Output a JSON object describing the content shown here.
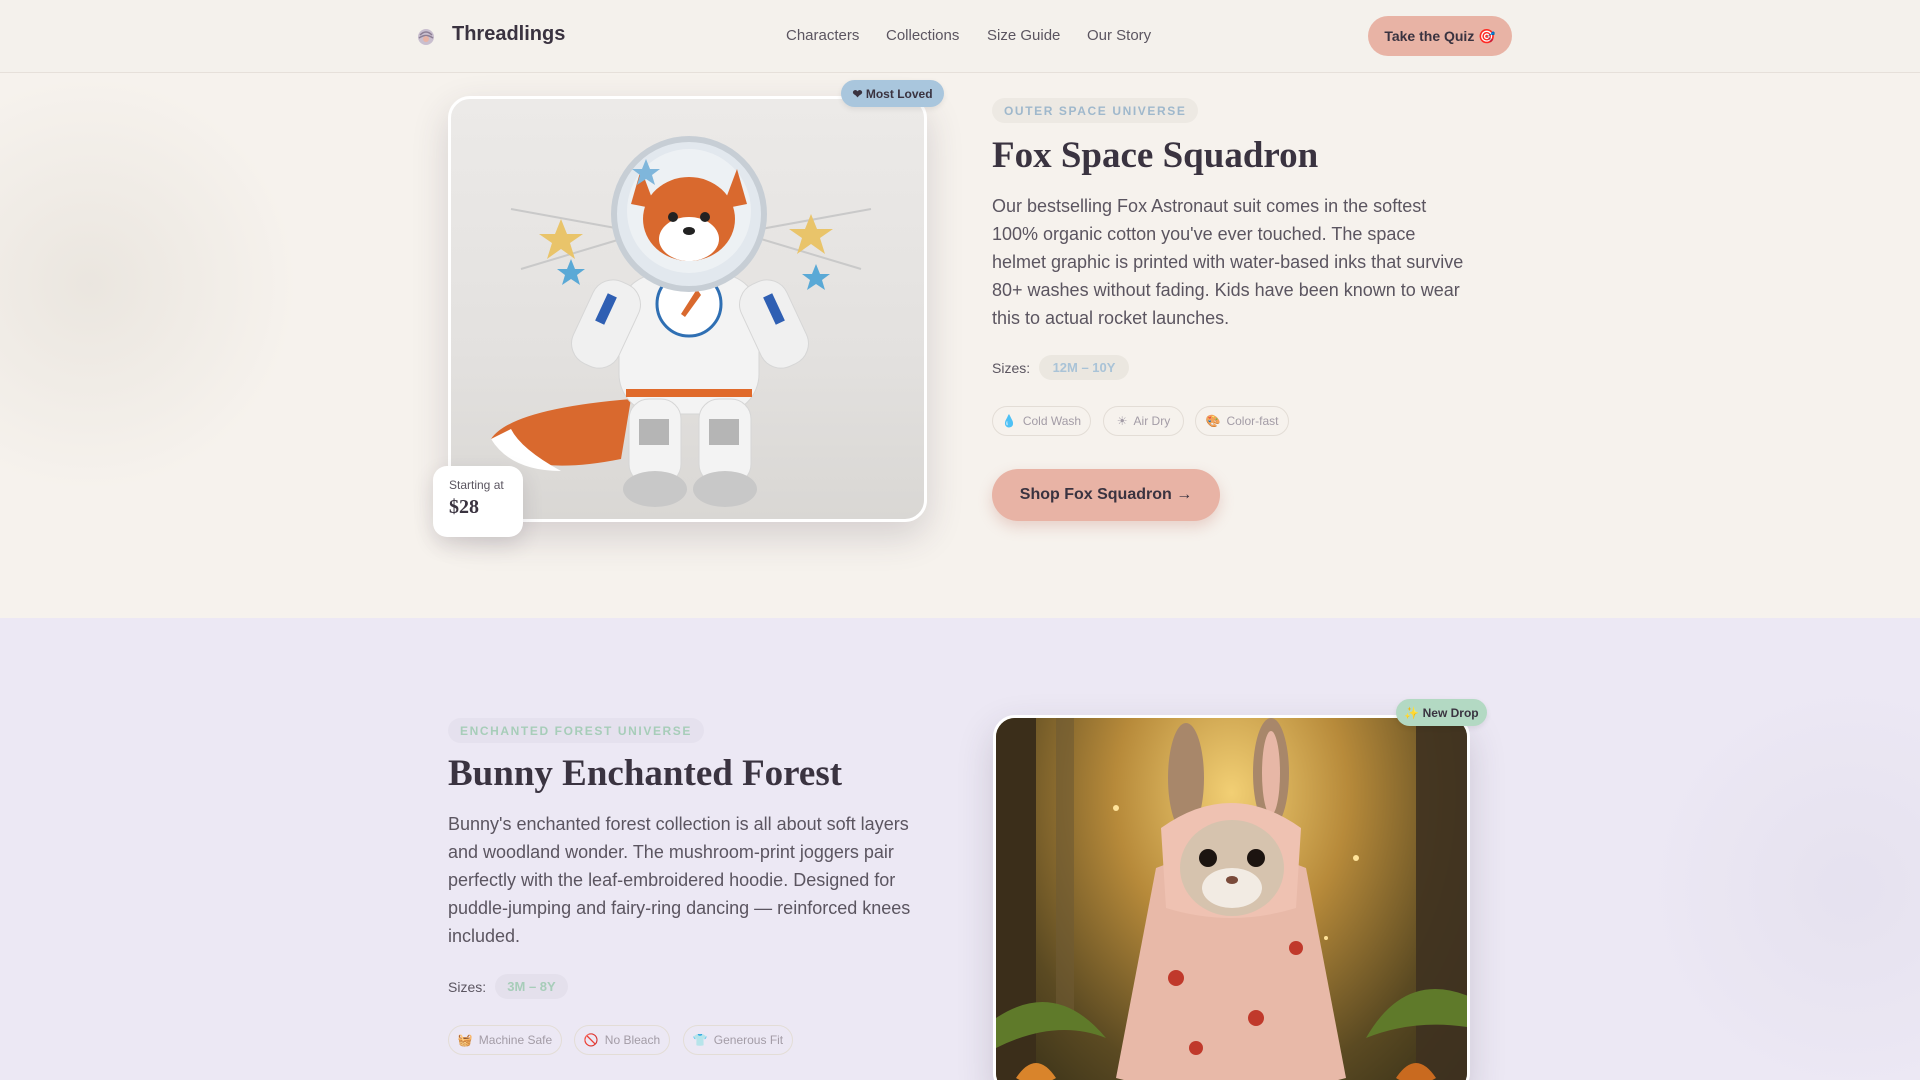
{
  "nav": {
    "brand": "Threadlings",
    "links": [
      "Characters",
      "Collections",
      "Size Guide",
      "Our Story"
    ],
    "cta_label": "Take the Quiz 🎯"
  },
  "fox": {
    "badge": "❤ Most Loved",
    "price_label": "Starting at",
    "price": "$28",
    "universe": "OUTER SPACE UNIVERSE",
    "title": "Fox Space Squadron",
    "description": "Our bestselling Fox Astronaut suit comes in the softest 100% organic cotton you've ever touched. The space helmet graphic is printed with water-based inks that survive 80+ washes without fading. Kids have been known to wear this to actual rocket launches.",
    "sizes_label": "Sizes:",
    "sizes": "12M – 10Y",
    "care": [
      {
        "icon": "💧",
        "label": "Cold Wash"
      },
      {
        "icon": "☀",
        "label": "Air Dry"
      },
      {
        "icon": "🎨",
        "label": "Color-fast"
      }
    ],
    "shop_label": "Shop Fox Squadron →",
    "image_colors": {
      "accent": "#a9c6dd",
      "fur": "#d9692e",
      "suit": "#f3f3f3"
    }
  },
  "bunny": {
    "badge": "✨ New Drop",
    "universe": "ENCHANTED FOREST UNIVERSE",
    "title": "Bunny Enchanted Forest",
    "description": "Bunny's enchanted forest collection is all about soft layers and woodland wonder. The mushroom-print joggers pair perfectly with the leaf-embroidered hoodie. Designed for puddle-jumping and fairy-ring dancing — reinforced knees included.",
    "sizes_label": "Sizes:",
    "sizes": "3M – 8Y",
    "care": [
      {
        "icon": "🧺",
        "label": "Machine Safe"
      },
      {
        "icon": "🚫",
        "label": "No Bleach"
      },
      {
        "icon": "👕",
        "label": "Generous Fit"
      }
    ]
  },
  "colors": {
    "accent": "#e8b3a5",
    "sky": "#a9c6dd",
    "mint": "#b3d9c3",
    "text": "#3a3340",
    "lavender_bg": "#ece8f4"
  }
}
